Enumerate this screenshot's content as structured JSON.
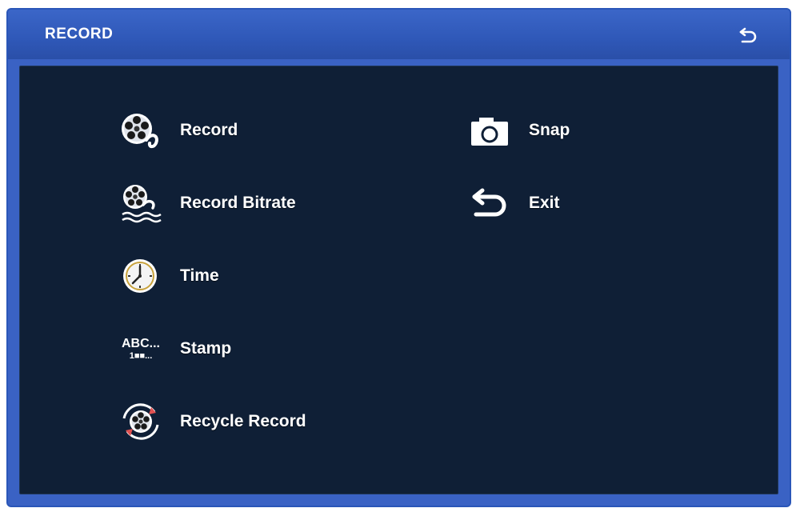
{
  "window": {
    "title": "RECORD"
  },
  "menu": {
    "left": [
      {
        "label": "Record",
        "icon": "film-reel-icon"
      },
      {
        "label": "Record Bitrate",
        "icon": "film-reel-wave-icon"
      },
      {
        "label": "Time",
        "icon": "clock-icon"
      },
      {
        "label": "Stamp",
        "icon": "stamp-text-icon",
        "icon_text": [
          "ABC...",
          "1■■..."
        ]
      },
      {
        "label": "Recycle Record",
        "icon": "recycle-reel-icon"
      }
    ],
    "right": [
      {
        "label": "Snap",
        "icon": "camera-icon"
      },
      {
        "label": "Exit",
        "icon": "return-arrow-icon"
      }
    ]
  },
  "colors": {
    "titlebar": "#2f58b8",
    "panel": "#0f1f36",
    "text": "#ffffff"
  }
}
